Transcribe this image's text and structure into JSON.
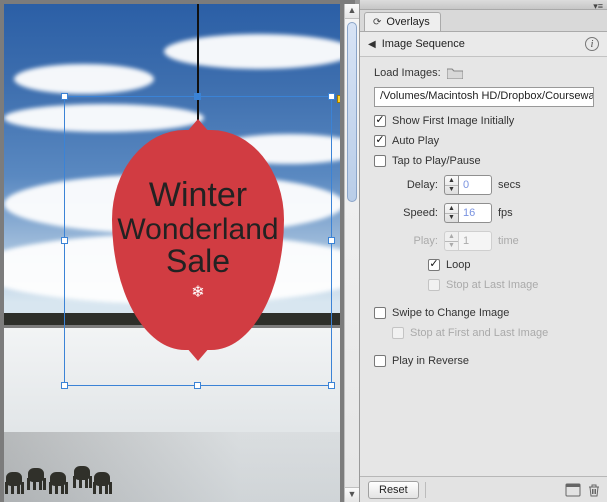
{
  "panel": {
    "tab_label": "Overlays",
    "breadcrumb": "Image Sequence",
    "load_images_label": "Load Images:",
    "path_value": "/Volumes/Macintosh HD/Dropbox/Courseware/in",
    "show_first_label": "Show First Image Initially",
    "autoplay_label": "Auto Play",
    "tap_label": "Tap to Play/Pause",
    "delay_label": "Delay:",
    "delay_value": "0",
    "delay_unit": "secs",
    "speed_label": "Speed:",
    "speed_value": "16",
    "speed_unit": "fps",
    "play_label": "Play:",
    "play_value": "1",
    "play_unit": "time",
    "loop_label": "Loop",
    "stop_last_label": "Stop at Last Image",
    "swipe_label": "Swipe to Change Image",
    "stop_first_last_label": "Stop at First and Last Image",
    "reverse_label": "Play in Reverse",
    "reset_label": "Reset",
    "checked": {
      "show_first": true,
      "autoplay": true,
      "tap": false,
      "loop": true,
      "stop_last": false,
      "swipe": false,
      "stop_first_last": false,
      "reverse": false
    }
  },
  "ornament": {
    "line1": "Winter",
    "line2": "Wonderland",
    "line3": "Sale"
  }
}
